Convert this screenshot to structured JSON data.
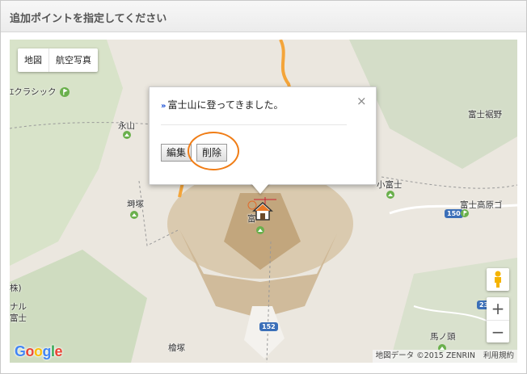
{
  "header": {
    "title": "追加ポイントを指定してください"
  },
  "map": {
    "type_control": {
      "map_label": "地図",
      "satellite_label": "航空写真"
    },
    "labels": {
      "classic": "ｴクラシック",
      "nagayama": "永山",
      "tsukazuka": "塒塚",
      "kinaru": "ナル",
      "fuji_left": "富士",
      "sho_left": "株)",
      "fuji_susono": "富士裾野",
      "kofuji": "小富士",
      "fuji_kogen": "富士高原ゴ",
      "mt_fuji": "富",
      "umanokubi": "馬ノ頭",
      "higashizuka": "檜塚"
    },
    "route_shields": {
      "r150": "150",
      "r152": "152",
      "r23": "23"
    },
    "infowindow": {
      "title": "富士山に登ってきました。",
      "arrow": "»",
      "close": "×",
      "edit_label": "編集",
      "delete_label": "削除"
    },
    "zoom": {
      "in": "+",
      "out": "−"
    },
    "attribution": {
      "data": "地図データ ©2015 ZENRIN",
      "terms": "利用規約"
    },
    "google": {
      "g": "G",
      "o1": "o",
      "o2": "o",
      "g2": "g",
      "l": "l",
      "e": "e"
    }
  },
  "colors": {
    "highlight_circle": "#f07d16",
    "road": "#f4a53a",
    "terrain": "#c9b28e"
  }
}
